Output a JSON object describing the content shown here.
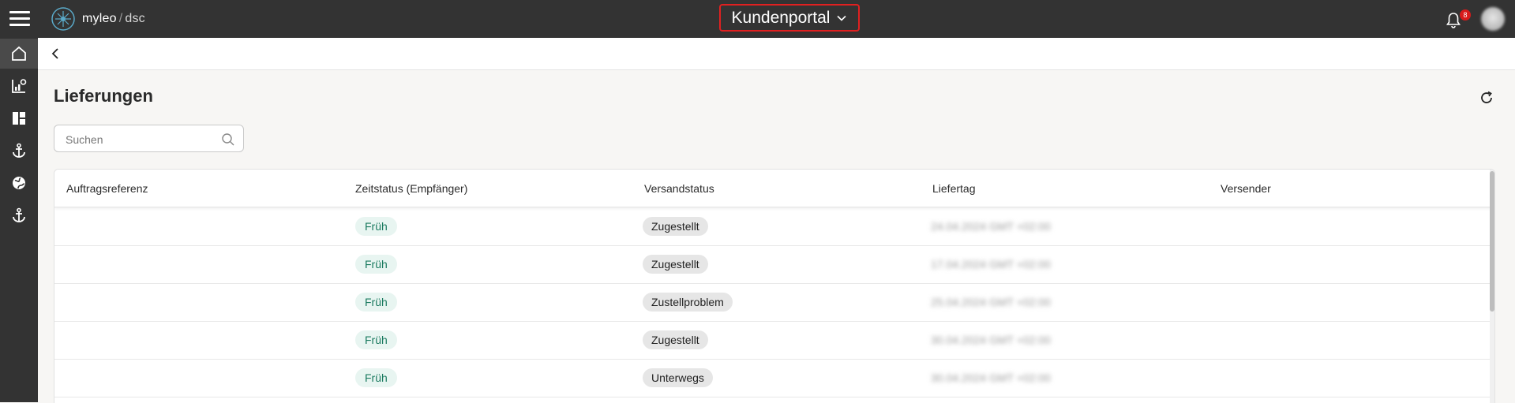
{
  "header": {
    "logo_brand": "myleo",
    "logo_slash": "/",
    "logo_product": "dsc",
    "portal_label": "Kundenportal",
    "notification_count": "8"
  },
  "sidebar": {
    "items": [
      {
        "icon": "home-icon",
        "active": true
      },
      {
        "icon": "analytics-icon",
        "active": false
      },
      {
        "icon": "dashboard-icon",
        "active": false
      },
      {
        "icon": "anchor-icon",
        "active": false
      },
      {
        "icon": "globe-icon",
        "active": false
      },
      {
        "icon": "anchor-icon",
        "active": false
      }
    ]
  },
  "page": {
    "title": "Lieferungen",
    "search_placeholder": "Suchen"
  },
  "table": {
    "columns": [
      "Auftragsreferenz",
      "Zeitstatus (Empfänger)",
      "Versandstatus",
      "Liefertag",
      "Versender"
    ],
    "rows": [
      {
        "reference": "",
        "time_status": "Früh",
        "shipping_status": "Zugestellt",
        "delivery_day": "24.04.2024 GMT +02:00",
        "sender": ""
      },
      {
        "reference": "",
        "time_status": "Früh",
        "shipping_status": "Zugestellt",
        "delivery_day": "17.04.2024 GMT +02:00",
        "sender": ""
      },
      {
        "reference": "",
        "time_status": "Früh",
        "shipping_status": "Zustellproblem",
        "delivery_day": "25.04.2024 GMT +02:00",
        "sender": ""
      },
      {
        "reference": "",
        "time_status": "Früh",
        "shipping_status": "Zugestellt",
        "delivery_day": "30.04.2024 GMT +02:00",
        "sender": ""
      },
      {
        "reference": "",
        "time_status": "Früh",
        "shipping_status": "Unterwegs",
        "delivery_day": "30.04.2024 GMT +02:00",
        "sender": ""
      }
    ]
  },
  "colors": {
    "topbar": "#333333",
    "portal_border": "#e02020",
    "early_pill_bg": "#e8f5f1",
    "early_pill_text": "#1a7a5f",
    "status_pill_bg": "#e6e6e6",
    "badge": "#d81b1b"
  }
}
